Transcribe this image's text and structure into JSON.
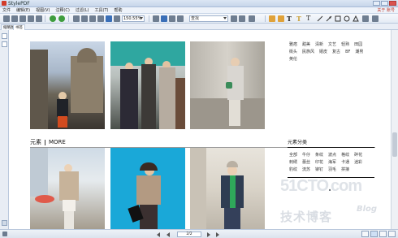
{
  "window": {
    "title": "StylePDF",
    "account_label": "关于 账号"
  },
  "menu": [
    "文件",
    "编辑(E)",
    "视图(V)",
    "注释(C)",
    "过滤(L)",
    "工具(T)",
    "帮助"
  ],
  "toolbar": {
    "zoom_value": "150.55%",
    "search_placeholder": "查找"
  },
  "tabs": [
    {
      "label": "缩略图",
      "active": false
    },
    {
      "label": "书签",
      "active": true
    }
  ],
  "document": {
    "tags_top": [
      "雅痞",
      "甜美",
      "清新",
      "文艺",
      "轻熟",
      "田园",
      "街头",
      "民族风",
      "嬉皮",
      "复古",
      "BF",
      "潮男",
      "英伦"
    ],
    "more_section": {
      "title": "元素",
      "more": "MORE"
    },
    "category_title": "元素分类",
    "tags_category": [
      "全部",
      "牛仔",
      "条纹",
      "波点",
      "格纹",
      "碎花",
      "刺绣",
      "蕾丝",
      "印花",
      "海军",
      "卡通",
      "迷彩",
      "豹纹",
      "流苏",
      "铆钉",
      "羽毛",
      "拼接"
    ]
  },
  "watermark": {
    "site_prefix": "51CTO",
    "site_dot": ".",
    "site_suffix": "com",
    "cn_text": "技术博客",
    "blog": "Blog"
  },
  "statusbar": {
    "page_indicator": "2/2"
  },
  "colors": {
    "titlebar": "#c7d6ea",
    "accent_red": "#c0392b",
    "photo_blue": "#1aa8d8"
  }
}
